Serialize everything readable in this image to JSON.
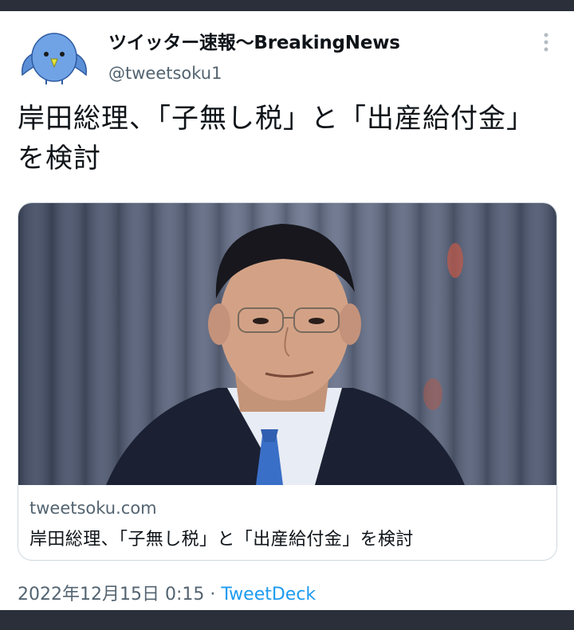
{
  "author": {
    "name": "ツイッター速報〜BreakingNews",
    "handle": "@tweetsoku1",
    "avatar_icon": "bird-avatar-icon"
  },
  "tweet": {
    "text": "岸田総理、「子無し税」と「出産給付金」を検討"
  },
  "card": {
    "domain": "tweetsoku.com",
    "title": "岸田総理、「子無し税」と「出産給付金」を検討",
    "image_desc": "man-in-suit-photo"
  },
  "meta": {
    "timestamp": "2022年12月15日 0:15",
    "separator": "·",
    "source": "TweetDeck"
  },
  "colors": {
    "accent": "#1d9bf0",
    "secondary_text": "#536471",
    "bar": "#2a2f3a"
  }
}
